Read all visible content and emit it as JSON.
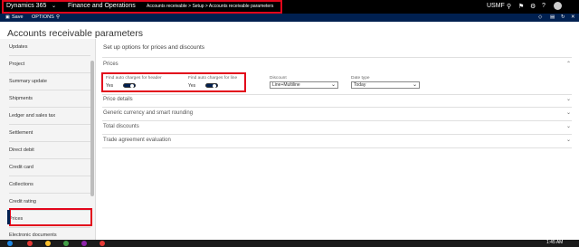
{
  "topbar": {
    "app_name": "Dynamics 365",
    "app_chevron": "chevron-down",
    "module": "Finance and Operations",
    "breadcrumb": "Accounts receivable  >  Setup  >  Accounts receivable parameters",
    "company": "USMF",
    "icons": [
      "search-icon",
      "notification-icon",
      "settings-icon",
      "help-icon",
      "user-icon"
    ]
  },
  "actionbar": {
    "save_label": "Save",
    "options_label": "OPTIONS",
    "search_icon": "search-icon"
  },
  "page": {
    "title": "Accounts receivable parameters",
    "description": "Set up options for prices and discounts"
  },
  "sidebar": {
    "items": [
      {
        "label": "Updates"
      },
      {
        "label": "Project"
      },
      {
        "label": "Summary update"
      },
      {
        "label": "Shipments"
      },
      {
        "label": "Ledger and sales tax"
      },
      {
        "label": "Settlement"
      },
      {
        "label": "Direct debit"
      },
      {
        "label": "Credit card"
      },
      {
        "label": "Collections"
      },
      {
        "label": "Credit rating"
      },
      {
        "label": "Prices"
      },
      {
        "label": "Electronic documents"
      }
    ],
    "selected": "Prices"
  },
  "prices": {
    "section_title": "Prices",
    "find_auto_charges_header_label": "Find auto charges for header",
    "find_auto_charges_header_value": "Yes",
    "find_auto_charges_line_label": "Find auto charges for line",
    "find_auto_charges_line_value": "Yes",
    "discount_label": "Discount",
    "discount_value": "Line+Multiline",
    "date_type_label": "Date type",
    "date_type_value": "Today"
  },
  "sections": {
    "price_details": "Price details",
    "generic_currency": "Generic currency and smart rounding",
    "total_discounts": "Total discounts",
    "trade_agreement": "Trade agreement evaluation"
  },
  "taskbar": {
    "clock": "1:45 AM"
  },
  "colors": {
    "nav_black": "#000000",
    "action_blue": "#002050",
    "highlight_red": "#e2061b"
  }
}
